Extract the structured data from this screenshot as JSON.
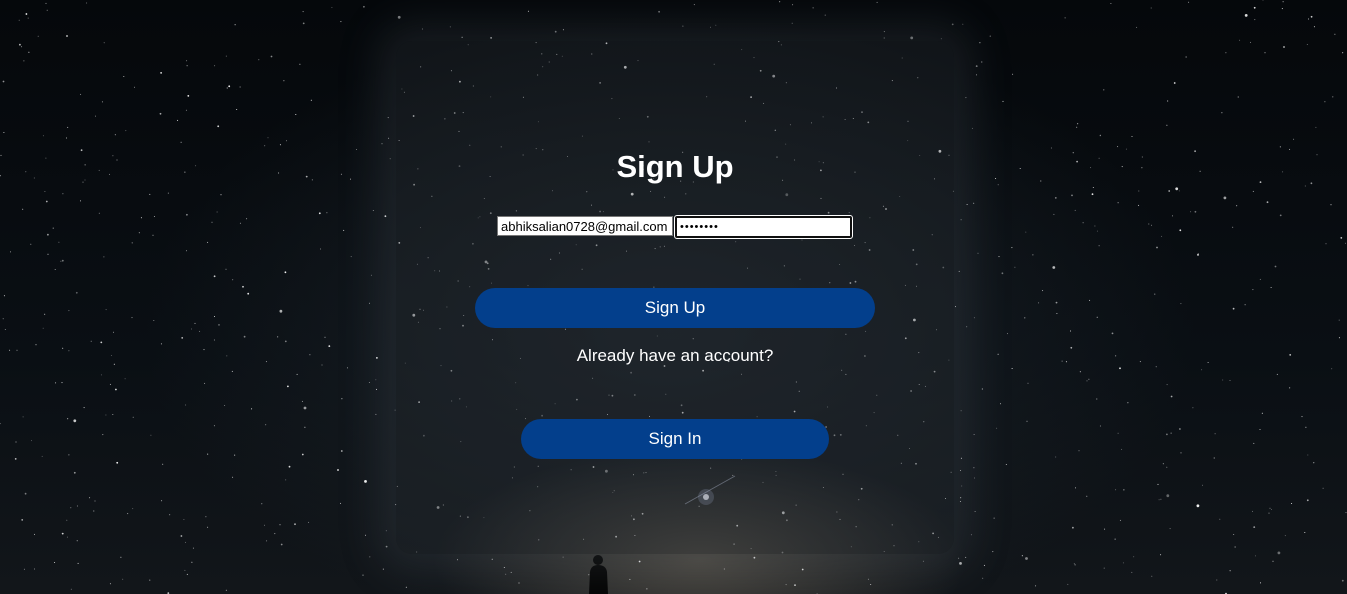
{
  "form": {
    "title": "Sign Up",
    "email_value": "abhiksalian0728@gmail.com",
    "password_value": "abcd1234",
    "signup_label": "Sign Up",
    "already_text": "Already have an account?",
    "signin_label": "Sign In"
  },
  "colors": {
    "button": "#033f8c",
    "text": "#ffffff"
  }
}
